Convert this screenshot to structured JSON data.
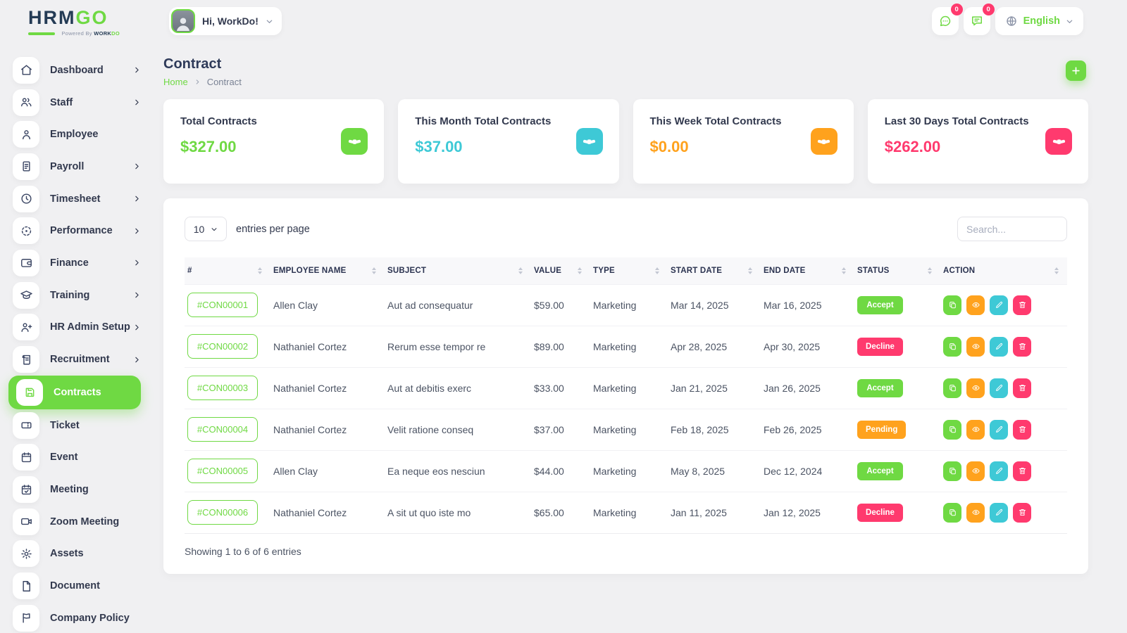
{
  "theme": {
    "colors": {
      "green": "#6fd943",
      "cyan": "#3ec9d6",
      "orange": "#ffa21d",
      "pink": "#ff3a6e",
      "navy": "#32394e"
    }
  },
  "icons": {
    "chevron_right": "chevron-right",
    "chevron_down": "chevron-down"
  },
  "topbar": {
    "logo": {
      "brand_primary": "HRM",
      "brand_accent": "GO",
      "tagline_prefix": "Powered By ",
      "tagline_brand": "WORK",
      "tagline_brand_accent": "DO"
    },
    "user": {
      "greeting": "Hi, WorkDo!",
      "avatar_icon": "person"
    },
    "notifications": [
      {
        "icon": "chat-dots",
        "count": "0"
      },
      {
        "icon": "chat-lines",
        "count": "0"
      }
    ],
    "language": {
      "icon": "globe",
      "label": "English"
    }
  },
  "sidebar": {
    "items": [
      {
        "label": "Dashboard",
        "icon": "home",
        "has_submenu": true,
        "active": false
      },
      {
        "label": "Staff",
        "icon": "users",
        "has_submenu": true,
        "active": false
      },
      {
        "label": "Employee",
        "icon": "user",
        "has_submenu": false,
        "active": false
      },
      {
        "label": "Payroll",
        "icon": "receipt",
        "has_submenu": true,
        "active": false
      },
      {
        "label": "Timesheet",
        "icon": "clock",
        "has_submenu": true,
        "active": false
      },
      {
        "label": "Performance",
        "icon": "target",
        "has_submenu": true,
        "active": false
      },
      {
        "label": "Finance",
        "icon": "wallet",
        "has_submenu": true,
        "active": false
      },
      {
        "label": "Training",
        "icon": "graduation-cap",
        "has_submenu": true,
        "active": false
      },
      {
        "label": "HR Admin Setup",
        "icon": "user-plus",
        "has_submenu": true,
        "active": false
      },
      {
        "label": "Recruitment",
        "icon": "scroll",
        "has_submenu": true,
        "active": false
      },
      {
        "label": "Contracts",
        "icon": "floppy",
        "has_submenu": false,
        "active": true
      },
      {
        "label": "Ticket",
        "icon": "ticket",
        "has_submenu": false,
        "active": false
      },
      {
        "label": "Event",
        "icon": "calendar",
        "has_submenu": false,
        "active": false
      },
      {
        "label": "Meeting",
        "icon": "calendar-check",
        "has_submenu": false,
        "active": false
      },
      {
        "label": "Zoom Meeting",
        "icon": "video-camera",
        "has_submenu": false,
        "active": false
      },
      {
        "label": "Assets",
        "icon": "cog",
        "has_submenu": false,
        "active": false
      },
      {
        "label": "Document",
        "icon": "file",
        "has_submenu": false,
        "active": false
      },
      {
        "label": "Company Policy",
        "icon": "flag",
        "has_submenu": false,
        "active": false
      }
    ]
  },
  "page": {
    "title": "Contract",
    "breadcrumb_home": "Home",
    "breadcrumb_current": "Contract",
    "add_button_icon": "plus"
  },
  "stats": [
    {
      "label": "Total Contracts",
      "value": "$327.00",
      "color": "green",
      "icon": "handshake"
    },
    {
      "label": "This Month Total Contracts",
      "value": "$37.00",
      "color": "cyan",
      "icon": "handshake"
    },
    {
      "label": "This Week Total Contracts",
      "value": "$0.00",
      "color": "orange",
      "icon": "handshake"
    },
    {
      "label": "Last 30 Days Total Contracts",
      "value": "$262.00",
      "color": "pink",
      "icon": "handshake"
    }
  ],
  "table": {
    "entries_select_value": "10",
    "entries_per_page_label": "entries per page",
    "search_placeholder": "Search...",
    "columns": [
      "#",
      "EMPLOYEE NAME",
      "SUBJECT",
      "VALUE",
      "TYPE",
      "START DATE",
      "END DATE",
      "STATUS",
      "ACTION"
    ],
    "rows": [
      {
        "id": "#CON00001",
        "employee": "Allen Clay",
        "subject": "Aut ad consequatur",
        "value": "$59.00",
        "type": "Marketing",
        "start_date": "Mar 14, 2025",
        "end_date": "Mar 16, 2025",
        "status": {
          "label": "Accept",
          "color": "green"
        }
      },
      {
        "id": "#CON00002",
        "employee": "Nathaniel Cortez",
        "subject": "Rerum esse tempor re",
        "value": "$89.00",
        "type": "Marketing",
        "start_date": "Apr 28, 2025",
        "end_date": "Apr 30, 2025",
        "status": {
          "label": "Decline",
          "color": "pink"
        }
      },
      {
        "id": "#CON00003",
        "employee": "Nathaniel Cortez",
        "subject": "Aut at debitis exerc",
        "value": "$33.00",
        "type": "Marketing",
        "start_date": "Jan 21, 2025",
        "end_date": "Jan 26, 2025",
        "status": {
          "label": "Accept",
          "color": "green"
        }
      },
      {
        "id": "#CON00004",
        "employee": "Nathaniel Cortez",
        "subject": "Velit ratione conseq",
        "value": "$37.00",
        "type": "Marketing",
        "start_date": "Feb 18, 2025",
        "end_date": "Feb 26, 2025",
        "status": {
          "label": "Pending",
          "color": "orange"
        }
      },
      {
        "id": "#CON00005",
        "employee": "Allen Clay",
        "subject": "Ea neque eos nesciun",
        "value": "$44.00",
        "type": "Marketing",
        "start_date": "May 8, 2025",
        "end_date": "Dec 12, 2024",
        "status": {
          "label": "Accept",
          "color": "green"
        }
      },
      {
        "id": "#CON00006",
        "employee": "Nathaniel Cortez",
        "subject": "A sit ut quo iste mo",
        "value": "$65.00",
        "type": "Marketing",
        "start_date": "Jan 11, 2025",
        "end_date": "Jan 12, 2025",
        "status": {
          "label": "Decline",
          "color": "pink"
        }
      }
    ],
    "actions": [
      {
        "name": "duplicate",
        "icon": "copy",
        "color": "green"
      },
      {
        "name": "view",
        "icon": "eye",
        "color": "orange"
      },
      {
        "name": "edit",
        "icon": "pencil",
        "color": "cyan"
      },
      {
        "name": "delete",
        "icon": "trash",
        "color": "pink"
      }
    ],
    "footer": "Showing 1 to 6 of 6 entries"
  }
}
